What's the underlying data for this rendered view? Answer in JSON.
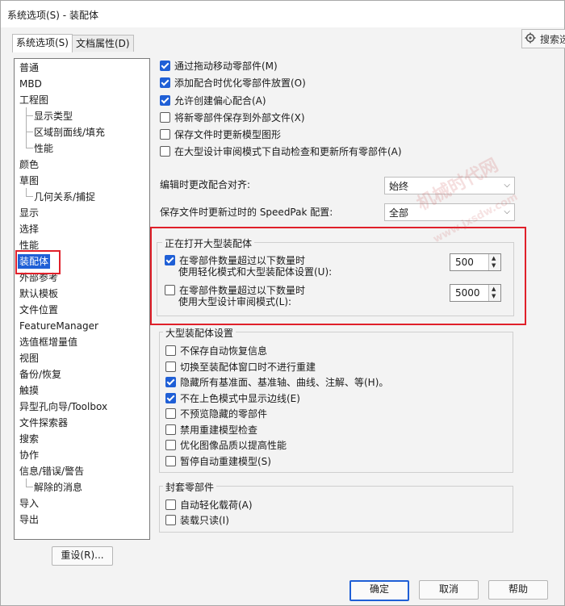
{
  "window": {
    "title": "系统选项(S) - 装配体"
  },
  "tabs": [
    {
      "label": "系统选项(S)",
      "active": true
    },
    {
      "label": "文档属性(D)",
      "active": false
    }
  ],
  "search": {
    "label": "搜索选"
  },
  "tree": {
    "items": [
      {
        "label": "普通",
        "level": 0
      },
      {
        "label": "MBD",
        "level": 0
      },
      {
        "label": "工程图",
        "level": 0
      },
      {
        "label": "显示类型",
        "level": 1
      },
      {
        "label": "区域剖面线/填充",
        "level": 1
      },
      {
        "label": "性能",
        "level": 1
      },
      {
        "label": "颜色",
        "level": 0
      },
      {
        "label": "草图",
        "level": 0
      },
      {
        "label": "几何关系/捕捉",
        "level": 1
      },
      {
        "label": "显示",
        "level": 0
      },
      {
        "label": "选择",
        "level": 0
      },
      {
        "label": "性能",
        "level": 0
      },
      {
        "label": "装配体",
        "level": 0,
        "selected": true
      },
      {
        "label": "外部参考",
        "level": 0
      },
      {
        "label": "默认模板",
        "level": 0
      },
      {
        "label": "文件位置",
        "level": 0
      },
      {
        "label": "FeatureManager",
        "level": 0
      },
      {
        "label": "选值框增量值",
        "level": 0
      },
      {
        "label": "视图",
        "level": 0
      },
      {
        "label": "备份/恢复",
        "level": 0
      },
      {
        "label": "触摸",
        "level": 0
      },
      {
        "label": "异型孔向导/Toolbox",
        "level": 0
      },
      {
        "label": "文件探索器",
        "level": 0
      },
      {
        "label": "搜索",
        "level": 0
      },
      {
        "label": "协作",
        "level": 0
      },
      {
        "label": "信息/错误/警告",
        "level": 0
      },
      {
        "label": "解除的消息",
        "level": 1
      },
      {
        "label": "导入",
        "level": 0
      },
      {
        "label": "导出",
        "level": 0
      }
    ]
  },
  "reset_button": "重设(R)...",
  "options_top": [
    {
      "label": "通过拖动移动零部件(M)",
      "checked": true
    },
    {
      "label": "添加配合时优化零部件放置(O)",
      "checked": true
    },
    {
      "label": "允许创建偏心配合(A)",
      "checked": true
    },
    {
      "label": "将新零部件保存到外部文件(X)",
      "checked": false
    },
    {
      "label": "保存文件时更新模型图形",
      "checked": false
    },
    {
      "label": "在大型设计审阅模式下自动检查和更新所有零部件(A)",
      "checked": false
    }
  ],
  "mate_alignment": {
    "label": "编辑时更改配合对齐:",
    "value": "始终"
  },
  "speedpak": {
    "label": "保存文件时更新过时的 SpeedPak 配置:",
    "value": "全部"
  },
  "opening_large": {
    "title": "正在打开大型装配体",
    "row1": {
      "line1": "在零部件数量超过以下数量时",
      "line2": "使用轻化模式和大型装配体设置(U):",
      "value": "500",
      "checked": true
    },
    "row2": {
      "line1": "在零部件数量超过以下数量时",
      "line2": "使用大型设计审阅模式(L):",
      "value": "5000",
      "checked": false
    }
  },
  "large_settings": {
    "title": "大型装配体设置",
    "options": [
      {
        "label": "不保存自动恢复信息",
        "checked": false
      },
      {
        "label": "切换至装配体窗口时不进行重建",
        "checked": false
      },
      {
        "label": "隐藏所有基准面、基准轴、曲线、注解、等(H)。",
        "checked": true
      },
      {
        "label": "不在上色模式中显示边线(E)",
        "checked": true
      },
      {
        "label": "不预览隐藏的零部件",
        "checked": false
      },
      {
        "label": "禁用重建模型检查",
        "checked": false
      },
      {
        "label": "优化图像品质以提高性能",
        "checked": false
      },
      {
        "label": "暂停自动重建模型(S)",
        "checked": false
      }
    ]
  },
  "envelope": {
    "title": "封套零部件",
    "options": [
      {
        "label": "自动轻化载荷(A)",
        "checked": false
      },
      {
        "label": "装载只读(I)",
        "checked": false
      }
    ]
  },
  "buttons": {
    "ok": "确定",
    "cancel": "取消",
    "help": "帮助"
  },
  "watermark": {
    "text1": "机械时代网",
    "text2": "www.jxsdw.com"
  },
  "colors": {
    "accent": "#1f5fd6",
    "highlight": "#e0202a"
  }
}
